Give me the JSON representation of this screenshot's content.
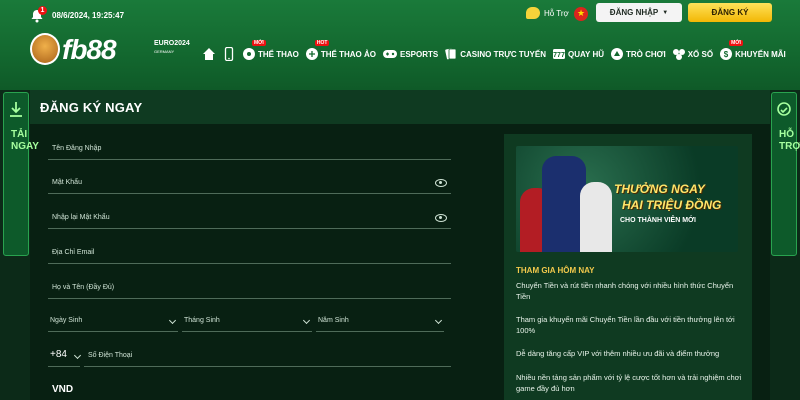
{
  "header": {
    "notification_count": "1",
    "datetime": "08/6/2024, 19:25:47",
    "support_label": "Hỗ Trợ",
    "login_label": "ĐĂNG NHẬP",
    "register_label": "ĐĂNG KÝ",
    "logo_text": "fb88",
    "euro_text": "EURO2024",
    "euro_sub": "GERMANY"
  },
  "nav": [
    {
      "label": "THỂ THAO",
      "badge": "MỚI"
    },
    {
      "label": "THỂ THAO ẢO",
      "badge": "HOT"
    },
    {
      "label": "ESPORTS",
      "badge": ""
    },
    {
      "label": "CASINO TRỰC TUYẾN",
      "badge": ""
    },
    {
      "label": "QUAY HŨ",
      "badge": ""
    },
    {
      "label": "TRÒ CHƠI",
      "badge": ""
    },
    {
      "label": "XỔ SỐ",
      "badge": ""
    },
    {
      "label": "KHUYẾN MÃI",
      "badge": "MỚI"
    }
  ],
  "page_title": "ĐĂNG KÝ NGAY",
  "form": {
    "username": "Tên Đăng Nhập",
    "password": "Mật Khẩu",
    "confirm_password": "Nhập lại Mật Khẩu",
    "email": "Địa Chỉ Email",
    "fullname": "Họ và Tên (Đầy Đủ)",
    "day": "Ngày Sinh",
    "month": "Tháng Sinh",
    "year": "Năm Sinh",
    "phone_code": "+84",
    "phone": "Số Điện Thoại",
    "currency": "VND"
  },
  "promo": {
    "banner_line1": "THƯỞNG NGAY",
    "banner_line2": "HAI TRIỆU ĐỒNG",
    "banner_line3": "CHO THÀNH VIÊN MỚI",
    "heading": "THAM GIA HÔM NAY",
    "p1": "Chuyển Tiền và rút tiền nhanh chóng với nhiều hình thức Chuyển Tiền",
    "p2": "Tham gia khuyến mãi Chuyển Tiền lần đầu với tiền thưởng lên tới 100%",
    "p3": "Dễ dàng tăng cấp VIP với thêm nhiều ưu đãi và điểm thưởng",
    "p4": "Nhiều nền tảng sản phẩm với tỷ lệ cược tốt hơn và trải nghiệm chơi game đầy đủ hơn"
  },
  "side": {
    "left": "TẢI NGAY",
    "right": "HỖ TRỢ"
  },
  "colors": {
    "header_green": "#13682f",
    "register_yellow": "#f2b705",
    "promo_heading": "#f2c94c"
  }
}
